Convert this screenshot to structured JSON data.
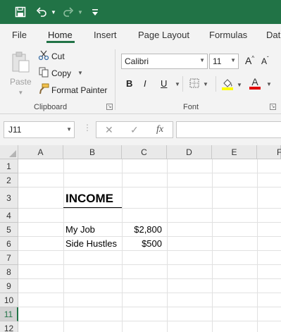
{
  "quick_access": {
    "icons": [
      "save-icon",
      "undo-icon",
      "redo-icon",
      "customize-icon"
    ]
  },
  "tabs": [
    {
      "label": "File",
      "active": false
    },
    {
      "label": "Home",
      "active": true
    },
    {
      "label": "Insert",
      "active": false
    },
    {
      "label": "Page Layout",
      "active": false
    },
    {
      "label": "Formulas",
      "active": false
    },
    {
      "label": "Dat",
      "active": false
    }
  ],
  "clipboard": {
    "paste_label": "Paste",
    "cut_label": "Cut",
    "copy_label": "Copy",
    "format_painter_label": "Format Painter",
    "group_label": "Clipboard"
  },
  "font": {
    "family": "Calibri",
    "size": "11",
    "grow_label": "A",
    "shrink_label": "A",
    "bold_label": "B",
    "italic_label": "I",
    "underline_label": "U",
    "font_color_label": "A",
    "group_label": "Font",
    "accent_fill": "#ffff00",
    "accent_font": "#e00000"
  },
  "formula_bar": {
    "name_box": "J11",
    "fx_label": "fx",
    "formula": ""
  },
  "sheet": {
    "columns": [
      "A",
      "B",
      "C",
      "D",
      "E",
      "F"
    ],
    "rows": [
      "1",
      "2",
      "3",
      "4",
      "5",
      "6",
      "7",
      "8",
      "9",
      "10",
      "11",
      "12"
    ],
    "selected_row": "11",
    "cells": {
      "B3": "INCOME",
      "B5": "My Job",
      "C5": "$2,800",
      "B6": "Side Hustles",
      "C6": "$500"
    }
  },
  "colors": {
    "brand": "#217346",
    "ribbon_bg": "#f3f3f3"
  }
}
